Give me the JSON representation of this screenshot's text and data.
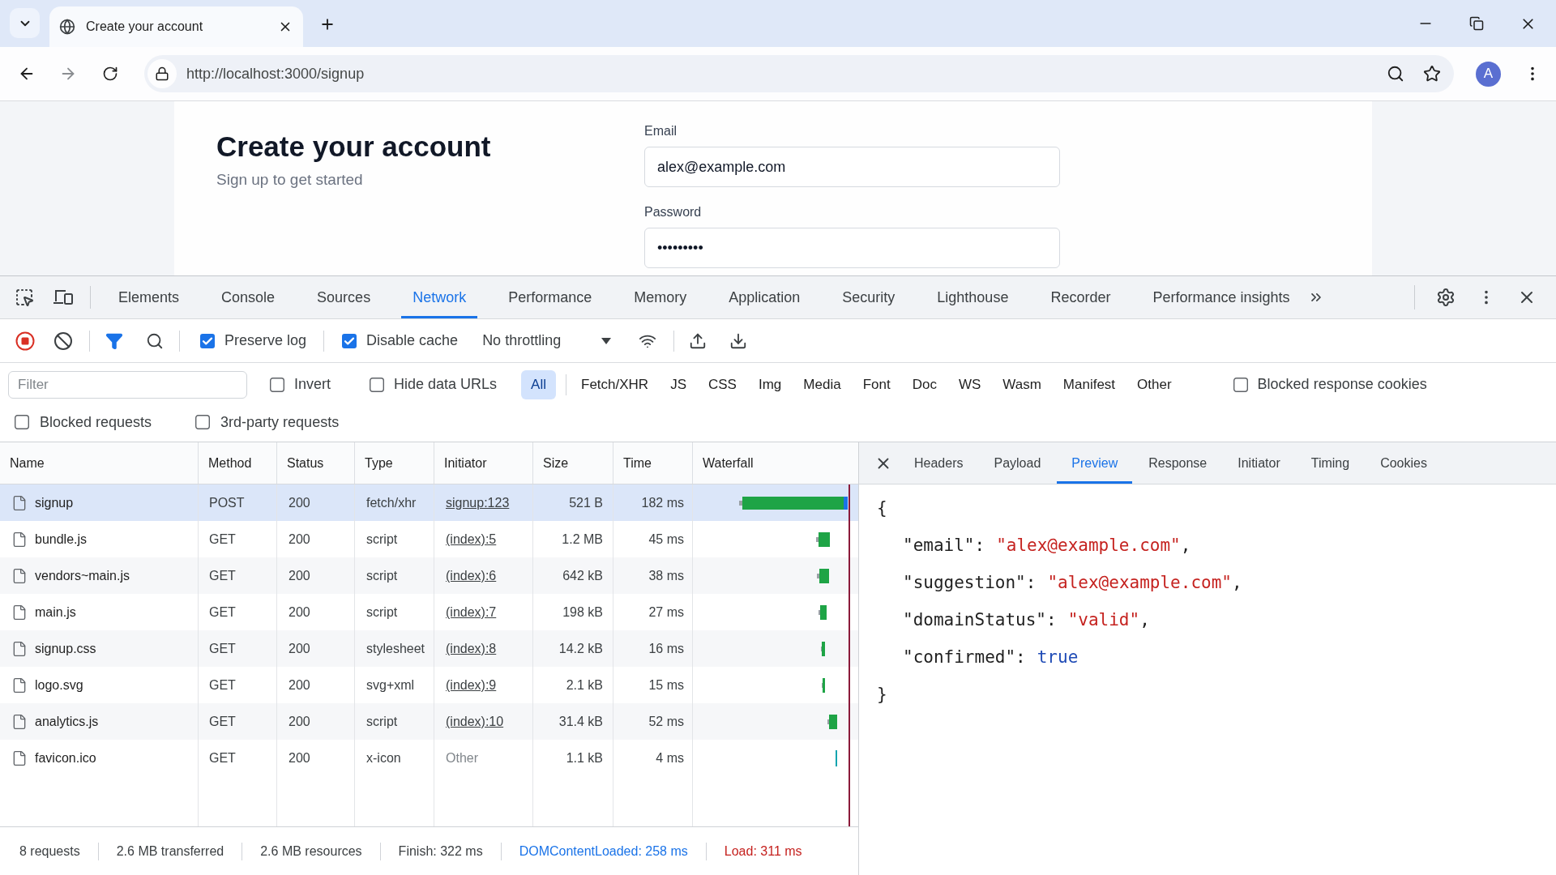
{
  "browser": {
    "tab": {
      "title": "Create your account"
    },
    "url": "http://localhost:3000/signup",
    "profile_initial": "A"
  },
  "page": {
    "heading": "Create your account",
    "subheading": "Sign up to get started",
    "fields": [
      {
        "label": "Email",
        "value": "alex@example.com"
      },
      {
        "label": "Password",
        "value": "•••••••••"
      }
    ]
  },
  "devtools": {
    "tabs": [
      {
        "label": "Elements",
        "selected": false
      },
      {
        "label": "Console",
        "selected": false
      },
      {
        "label": "Sources",
        "selected": false
      },
      {
        "label": "Network",
        "selected": true
      },
      {
        "label": "Performance",
        "selected": false
      },
      {
        "label": "Memory",
        "selected": false
      },
      {
        "label": "Application",
        "selected": false
      },
      {
        "label": "Security",
        "selected": false
      },
      {
        "label": "Lighthouse",
        "selected": false
      },
      {
        "label": "Recorder",
        "selected": false
      },
      {
        "label": "Performance insights",
        "selected": false
      }
    ],
    "toolbar": {
      "recording": true,
      "checkboxes": [
        {
          "label": "Preserve log",
          "checked": true
        },
        {
          "label": "Disable cache",
          "checked": true
        }
      ],
      "throttling": "No throttling"
    },
    "filter": {
      "placeholder": "Filter",
      "checkboxes": [
        {
          "label": "Invert",
          "checked": false
        },
        {
          "label": "Hide data URLs",
          "checked": false
        }
      ],
      "types": [
        {
          "label": "All",
          "selected": true
        },
        {
          "label": "Fetch/XHR",
          "selected": false
        },
        {
          "label": "JS",
          "selected": false
        },
        {
          "label": "CSS",
          "selected": false
        },
        {
          "label": "Img",
          "selected": false
        },
        {
          "label": "Media",
          "selected": false
        },
        {
          "label": "Font",
          "selected": false
        },
        {
          "label": "Doc",
          "selected": false
        },
        {
          "label": "WS",
          "selected": false
        },
        {
          "label": "Wasm",
          "selected": false
        },
        {
          "label": "Manifest",
          "selected": false
        },
        {
          "label": "Other",
          "selected": false
        }
      ],
      "cookie_checkbox": {
        "label": "Blocked response cookies",
        "checked": false
      },
      "more_checkboxes": [
        {
          "label": "Blocked requests",
          "checked": false
        },
        {
          "label": "3rd-party requests",
          "checked": false
        }
      ]
    },
    "network": {
      "columns": [
        "Name",
        "Method",
        "Status",
        "Type",
        "Initiator",
        "Size",
        "Time",
        "Waterfall"
      ],
      "rows": [
        {
          "name": "signup",
          "method": "POST",
          "status": "200",
          "type": "fetch/xhr",
          "initiator": {
            "text": "signup:123",
            "kind": "link"
          },
          "size": "521 B",
          "time": "182 ms",
          "selected": true
        },
        {
          "name": "bundle.js",
          "method": "GET",
          "status": "200",
          "type": "script",
          "initiator": {
            "text": "(index):5",
            "kind": "link"
          },
          "size": "1.2 MB",
          "time": "45 ms",
          "selected": false
        },
        {
          "name": "vendors~main.js",
          "method": "GET",
          "status": "200",
          "type": "script",
          "initiator": {
            "text": "(index):6",
            "kind": "link"
          },
          "size": "642 kB",
          "time": "38 ms",
          "selected": false
        },
        {
          "name": "main.js",
          "method": "GET",
          "status": "200",
          "type": "script",
          "initiator": {
            "text": "(index):7",
            "kind": "link"
          },
          "size": "198 kB",
          "time": "27 ms",
          "selected": false
        },
        {
          "name": "signup.css",
          "method": "GET",
          "status": "200",
          "type": "stylesheet",
          "initiator": {
            "text": "(index):8",
            "kind": "link"
          },
          "size": "14.2 kB",
          "time": "16 ms",
          "selected": false
        },
        {
          "name": "logo.svg",
          "method": "GET",
          "status": "200",
          "type": "svg+xml",
          "initiator": {
            "text": "(index):9",
            "kind": "link"
          },
          "size": "2.1 kB",
          "time": "15 ms",
          "selected": false
        },
        {
          "name": "analytics.js",
          "method": "GET",
          "status": "200",
          "type": "script",
          "initiator": {
            "text": "(index):10",
            "kind": "link"
          },
          "size": "31.4 kB",
          "time": "52 ms",
          "selected": false
        },
        {
          "name": "favicon.ico",
          "method": "GET",
          "status": "200",
          "type": "x-icon",
          "initiator": {
            "text": "Other",
            "kind": "plain"
          },
          "size": "1.1 kB",
          "time": "4 ms",
          "selected": false
        }
      ]
    },
    "status_bar": [
      {
        "text": "8 requests",
        "color": "#3c4043"
      },
      {
        "text": "2.6 MB transferred",
        "color": "#3c4043"
      },
      {
        "text": "2.6 MB resources",
        "color": "#3c4043"
      },
      {
        "text": "Finish: 322 ms",
        "color": "#3c4043"
      },
      {
        "text": "DOMContentLoaded: 258 ms",
        "color": "#1a73e8"
      },
      {
        "text": "Load: 311 ms",
        "color": "#c5221f"
      }
    ],
    "details": {
      "tabs": [
        {
          "label": "Headers",
          "selected": false
        },
        {
          "label": "Payload",
          "selected": false
        },
        {
          "label": "Preview",
          "selected": true
        },
        {
          "label": "Response",
          "selected": false
        },
        {
          "label": "Initiator",
          "selected": false
        },
        {
          "label": "Timing",
          "selected": false
        },
        {
          "label": "Cookies",
          "selected": false
        }
      ],
      "preview": {
        "open": "{",
        "entries": [
          {
            "key": "\"email\":",
            "value": "\"alex@example.com\"",
            "kind": "string",
            "separator": ","
          },
          {
            "key": "\"suggestion\":",
            "value": "\"alex@example.com\"",
            "kind": "string",
            "separator": ","
          },
          {
            "key": "\"domainStatus\":",
            "value": "\"valid\"",
            "kind": "string",
            "separator": ","
          },
          {
            "key": "\"confirmed\":",
            "value": "true",
            "kind": "boolean"
          }
        ],
        "close": "}"
      }
    }
  }
}
